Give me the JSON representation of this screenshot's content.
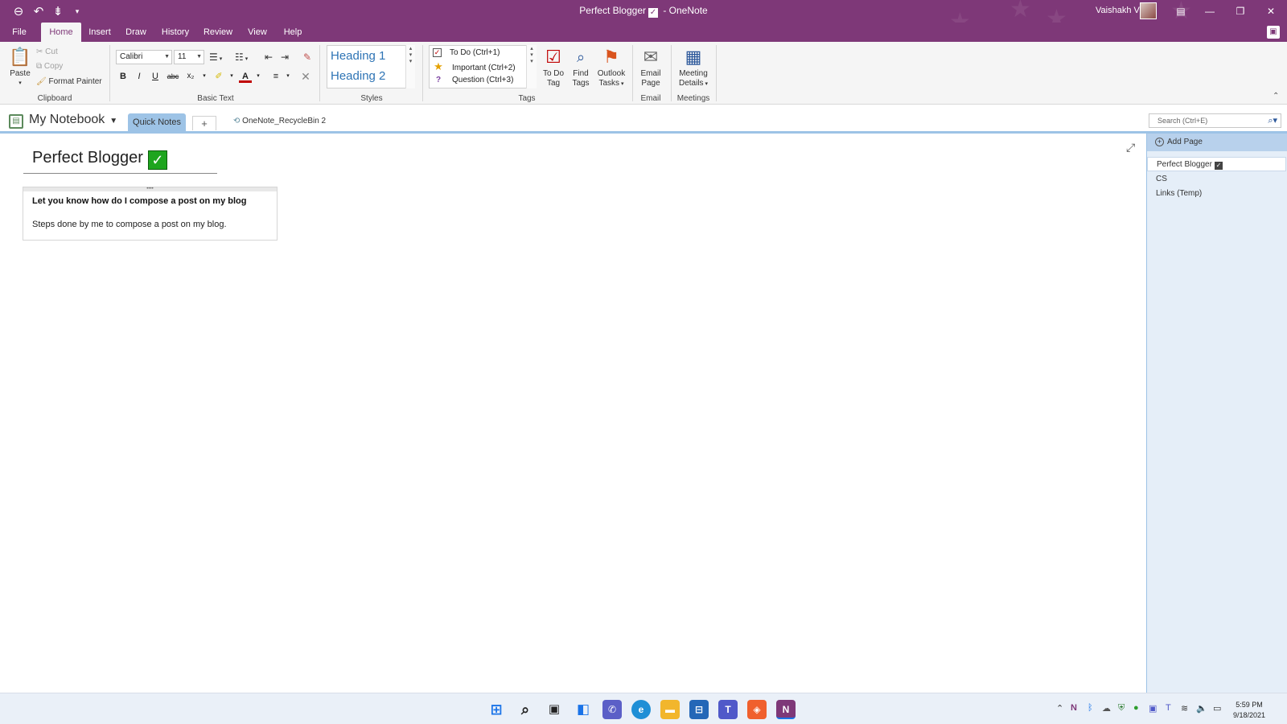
{
  "window": {
    "title": "Perfect Blogger",
    "app_name": "- OneNote",
    "user": "Vaishakh V"
  },
  "ribbon_tabs": [
    "File",
    "Home",
    "Insert",
    "Draw",
    "History",
    "Review",
    "View",
    "Help"
  ],
  "active_tab": "Home",
  "clipboard": {
    "paste": "Paste",
    "cut": "Cut",
    "copy": "Copy",
    "format_painter": "Format Painter",
    "label": "Clipboard"
  },
  "basic_text": {
    "font": "Calibri",
    "size": "11",
    "bold": "B",
    "italic": "I",
    "underline": "U",
    "strike": "abc",
    "subscript": "x₂",
    "label": "Basic Text"
  },
  "styles": {
    "heading1": "Heading 1",
    "heading2": "Heading 2",
    "label": "Styles"
  },
  "tags": {
    "todo": "To Do (Ctrl+1)",
    "important": "Important (Ctrl+2)",
    "question": "Question (Ctrl+3)",
    "todo_tag_1": "To Do",
    "todo_tag_2": "Tag",
    "find_tags_1": "Find",
    "find_tags_2": "Tags",
    "outlook_tasks_1": "Outlook",
    "outlook_tasks_2": "Tasks",
    "label": "Tags"
  },
  "email": {
    "email_page_1": "Email",
    "email_page_2": "Page",
    "label": "Email"
  },
  "meetings": {
    "meeting_details_1": "Meeting",
    "meeting_details_2": "Details",
    "label": "Meetings"
  },
  "notebook": {
    "name": "My Notebook",
    "section": "Quick Notes",
    "add_section": "+",
    "recycle_bin": "OneNote_RecycleBin 2",
    "search_placeholder": "Search (Ctrl+E)"
  },
  "page": {
    "title": "Perfect Blogger",
    "note_heading": "Let you know how do I compose a post on my blog",
    "note_body": "Steps done by me to compose a post on my blog."
  },
  "page_list": {
    "add_page": "Add Page",
    "pages": [
      "Perfect Blogger",
      "CS",
      "Links (Temp)"
    ]
  },
  "clock": {
    "time": "5:59 PM",
    "date": "9/18/2021"
  },
  "colors": {
    "accent": "#7e3878",
    "section": "#9dc3e6",
    "pagelist_bg": "#e5eef8"
  }
}
